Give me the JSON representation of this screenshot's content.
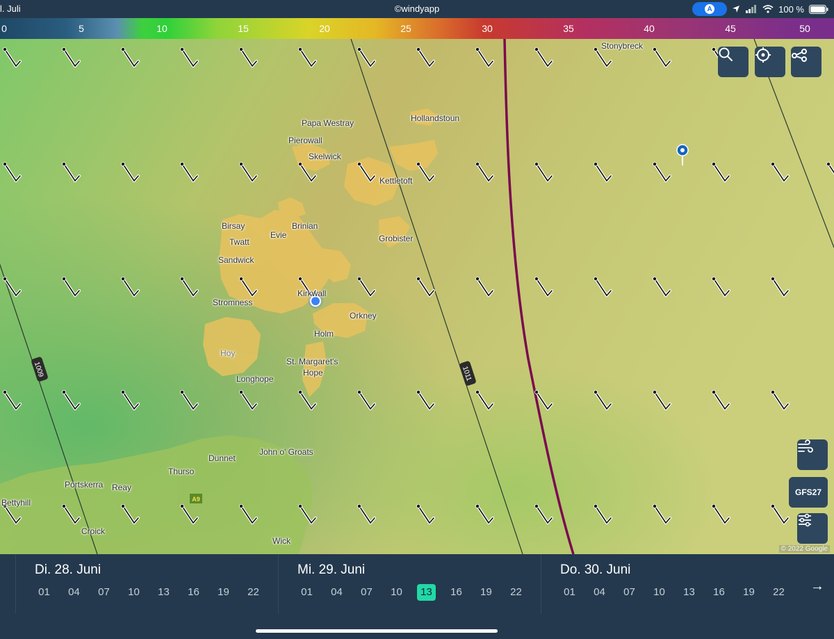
{
  "status": {
    "date": "l. Juli",
    "app_credit": "©windyapp",
    "nav_letter": "A",
    "battery": "100 %"
  },
  "scale": {
    "labels": [
      "0",
      "5",
      "10",
      "15",
      "20",
      "25",
      "30",
      "35",
      "40",
      "45",
      "50"
    ]
  },
  "map": {
    "places": [
      "Stonybreck",
      "Papa Westray",
      "Hollandstoun",
      "Pierowall",
      "Skelwick",
      "Kettletoft",
      "Birsay",
      "Brinian",
      "Evie",
      "Twatt",
      "Grobister",
      "Sandwick",
      "Kirkwall",
      "Stromness",
      "Orkney",
      "Holm",
      "Hoy",
      "St. Margaret's",
      "Hope",
      "Longhope",
      "John o' Groats",
      "Dunnet",
      "Thurso",
      "Portskerra",
      "Reay",
      "Bettyhill",
      "Croick",
      "Wick",
      "A9"
    ],
    "isobars": [
      "1009",
      "1011"
    ],
    "attribution": "© 2022 Google"
  },
  "controls": {
    "search": "search-icon",
    "locate": "crosshair-icon",
    "route": "route-icon",
    "wind_layer": "wind-icon",
    "model_label": "GFS27",
    "settings": "sliders-icon"
  },
  "timeline": {
    "days": [
      {
        "label": "Di. 28. Juni",
        "hours": [
          "01",
          "04",
          "07",
          "10",
          "13",
          "16",
          "19",
          "22"
        ],
        "active_index": -1
      },
      {
        "label": "Mi. 29. Juni",
        "hours": [
          "01",
          "04",
          "07",
          "10",
          "13",
          "16",
          "19",
          "22"
        ],
        "active_index": 4
      },
      {
        "label": "Do. 30. Juni",
        "hours": [
          "01",
          "04",
          "07",
          "10",
          "13",
          "16",
          "19",
          "22"
        ],
        "active_index": -1
      }
    ],
    "active_hour": "13",
    "next_icon": "arrow-right-icon"
  },
  "colors": {
    "active_hour": "#22d9a6",
    "panel": "#24394d",
    "button": "#2e475e",
    "front_line": "#7a0a4f",
    "location_dot": "#3b82f6",
    "pin": "#1565c0"
  }
}
